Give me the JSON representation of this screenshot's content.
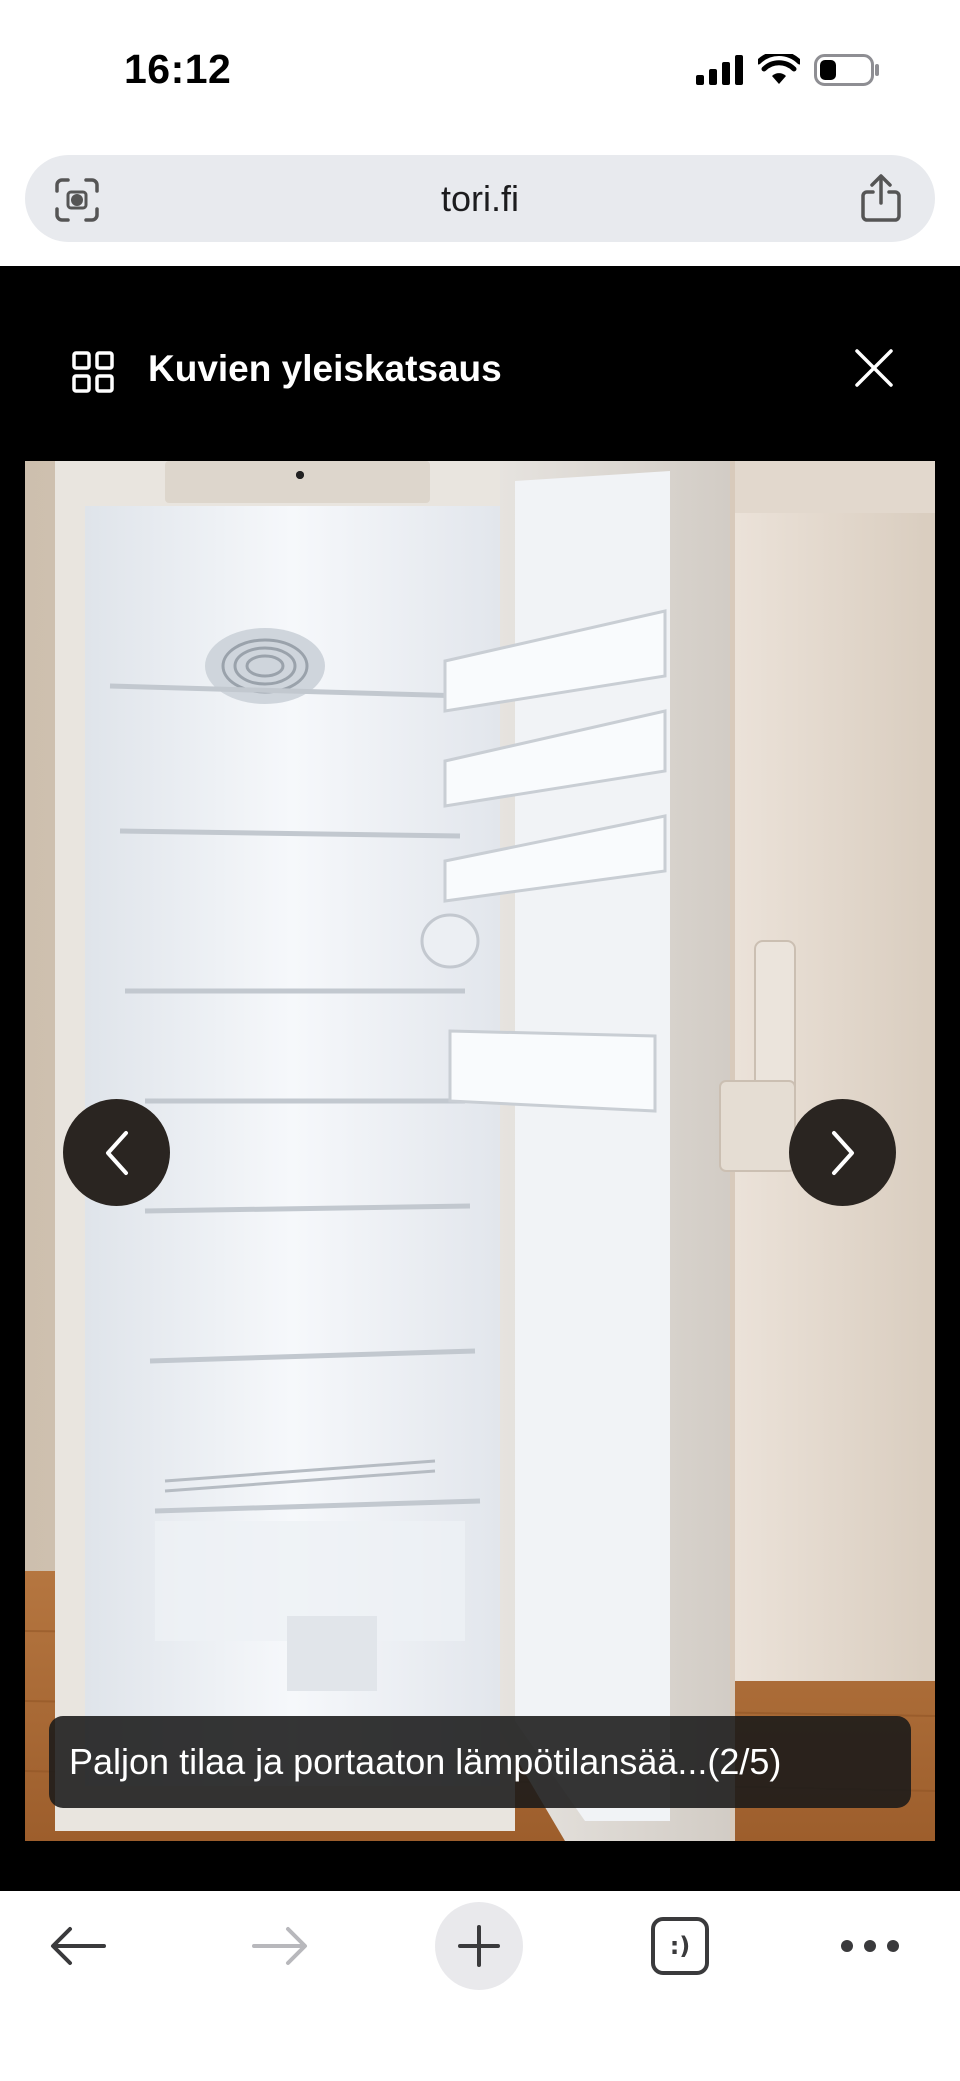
{
  "status_bar": {
    "time": "16:12"
  },
  "browser": {
    "url": "tori.fi",
    "left_icon": "camera-scan-icon",
    "right_icon": "share-icon"
  },
  "viewer": {
    "title": "Kuvien yleiskatsaus",
    "caption": "Paljon tilaa ja portaaton lämpötilansää...(2/5)",
    "image_index": 2,
    "image_count": 5,
    "icons": {
      "overview": "grid-icon",
      "close": "close-icon",
      "prev": "chevron-left-icon",
      "next": "chevron-right-icon"
    }
  },
  "toolbar": {
    "tabs_label": ":)",
    "icons": [
      "back-arrow-icon",
      "forward-arrow-icon",
      "plus-icon",
      "tabs-icon",
      "more-icon"
    ]
  },
  "colors": {
    "viewer_bg": "#000000",
    "address_bar_bg": "#e8eaee",
    "nav_button_bg": "#2a2521",
    "floor": "#b9753d"
  }
}
